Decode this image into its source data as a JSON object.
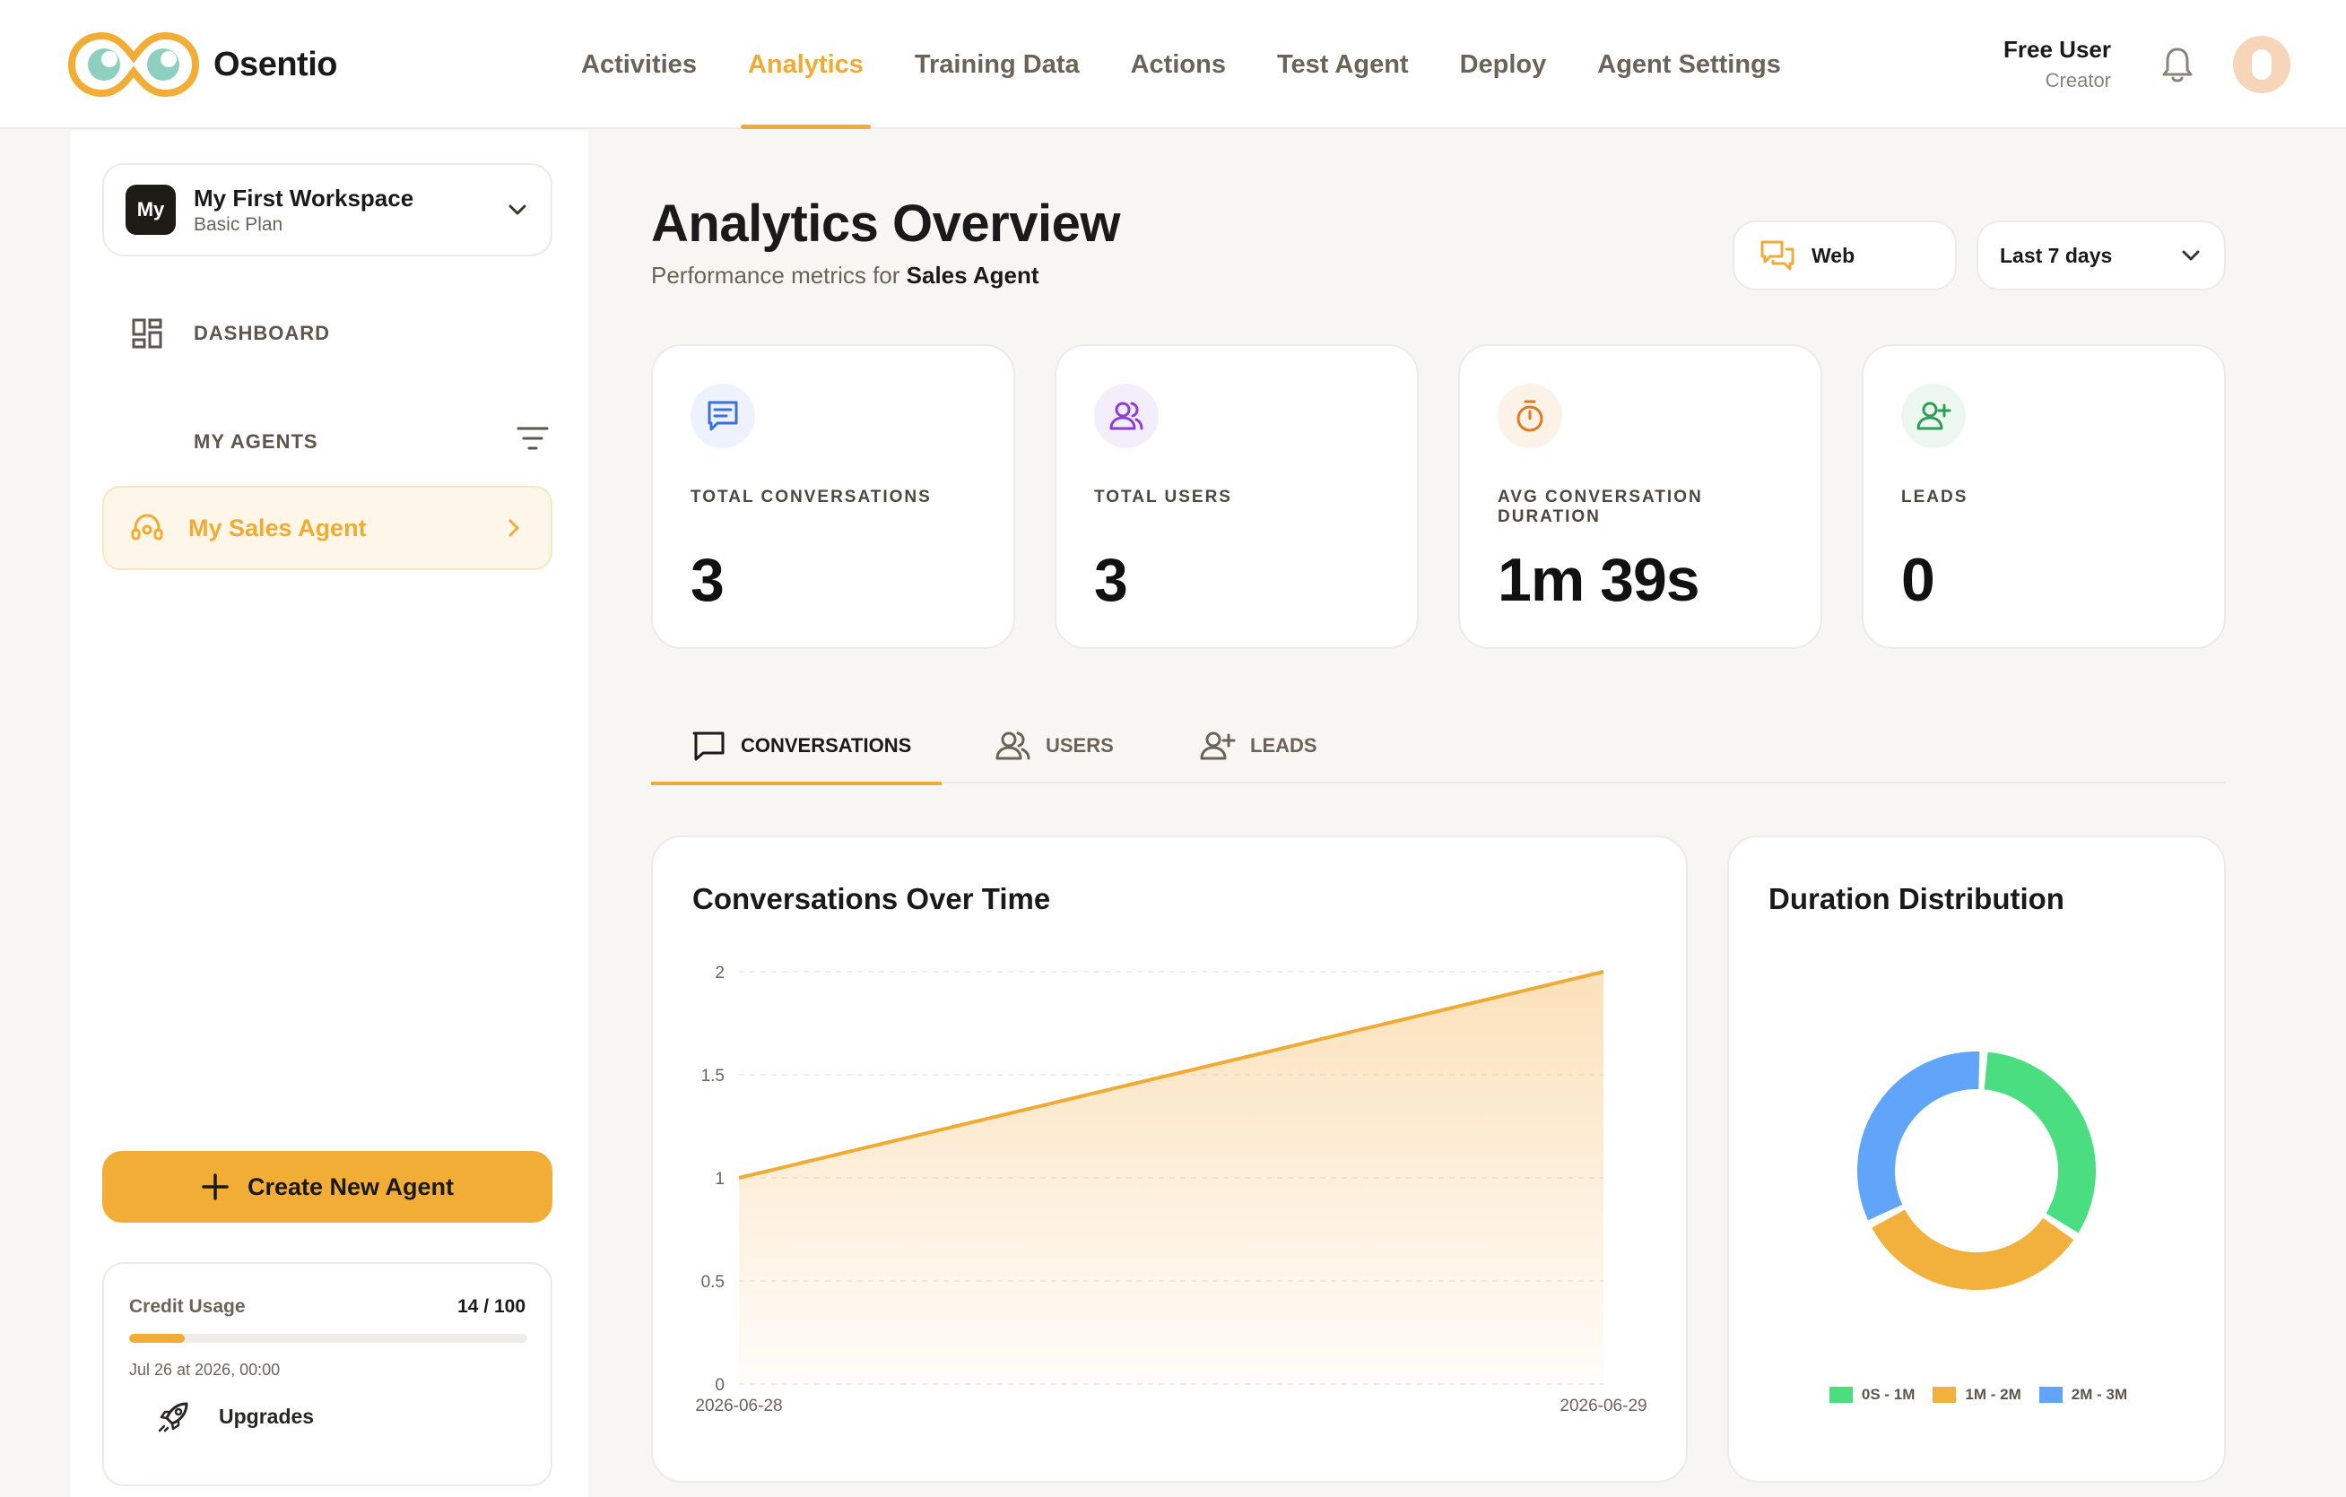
{
  "app": {
    "name": "Osentio"
  },
  "nav": {
    "items": [
      "Activities",
      "Analytics",
      "Training Data",
      "Actions",
      "Test Agent",
      "Deploy",
      "Agent Settings"
    ],
    "active": "Analytics"
  },
  "user": {
    "name": "Free User",
    "role": "Creator"
  },
  "sidebar": {
    "workspace": {
      "badge": "My",
      "name": "My First Workspace",
      "plan": "Basic Plan"
    },
    "dashboard_label": "DASHBOARD",
    "agents_header": "MY AGENTS",
    "agents": [
      {
        "label": "My Sales Agent"
      }
    ],
    "create_label": "Create New Agent",
    "credit": {
      "title": "Credit Usage",
      "count": "14 / 100",
      "fraction": 0.14,
      "date": "Jul 26 at 2026, 00:00",
      "upgrade_label": "Upgrades"
    }
  },
  "page": {
    "title": "Analytics Overview",
    "subtitle_prefix": "Performance metrics for",
    "agent_name": "Sales Agent",
    "channel_filter": "Web",
    "range_filter": "Last 7 days"
  },
  "stats": [
    {
      "label": "TOTAL CONVERSATIONS",
      "value": "3",
      "icon": "chat-icon",
      "icon_color": "#3b6fe0",
      "icon_bg": "#eef2fd"
    },
    {
      "label": "TOTAL USERS",
      "value": "3",
      "icon": "users-icon",
      "icon_color": "#8a3fd6",
      "icon_bg": "#f4eefc"
    },
    {
      "label": "AVG CONVERSATION DURATION",
      "value": "1m 39s",
      "icon": "timer-icon",
      "icon_color": "#e07a1f",
      "icon_bg": "#fdf2e7"
    },
    {
      "label": "LEADS",
      "value": "0",
      "icon": "add-user-icon",
      "icon_color": "#2e9e57",
      "icon_bg": "#ebf7ef"
    }
  ],
  "tabs": [
    {
      "label": "CONVERSATIONS",
      "icon": "chat-outline-icon"
    },
    {
      "label": "USERS",
      "icon": "users-outline-icon"
    },
    {
      "label": "LEADS",
      "icon": "add-user-outline-icon"
    }
  ],
  "charts": {
    "line_title": "Conversations Over Time",
    "donut_title": "Duration Distribution"
  },
  "colors": {
    "accent": "#f0ab34",
    "green": "#4ade80",
    "orange": "#f2b03c",
    "blue": "#60a5fa"
  },
  "chart_data": [
    {
      "type": "area",
      "title": "Conversations Over Time",
      "x": [
        "2026-06-28",
        "2026-06-29"
      ],
      "values": [
        1,
        2
      ],
      "ylim": [
        0,
        2
      ],
      "yticks": [
        "0",
        "0.5",
        "1",
        "1.5",
        "2"
      ],
      "grid": true
    },
    {
      "type": "pie",
      "title": "Duration Distribution",
      "categories": [
        "0S - 1M",
        "1M - 2M",
        "2M - 3M"
      ],
      "values": [
        1,
        1,
        1
      ],
      "colors": [
        "#4ade80",
        "#f2b03c",
        "#60a5fa"
      ],
      "legend": "bottom"
    }
  ]
}
